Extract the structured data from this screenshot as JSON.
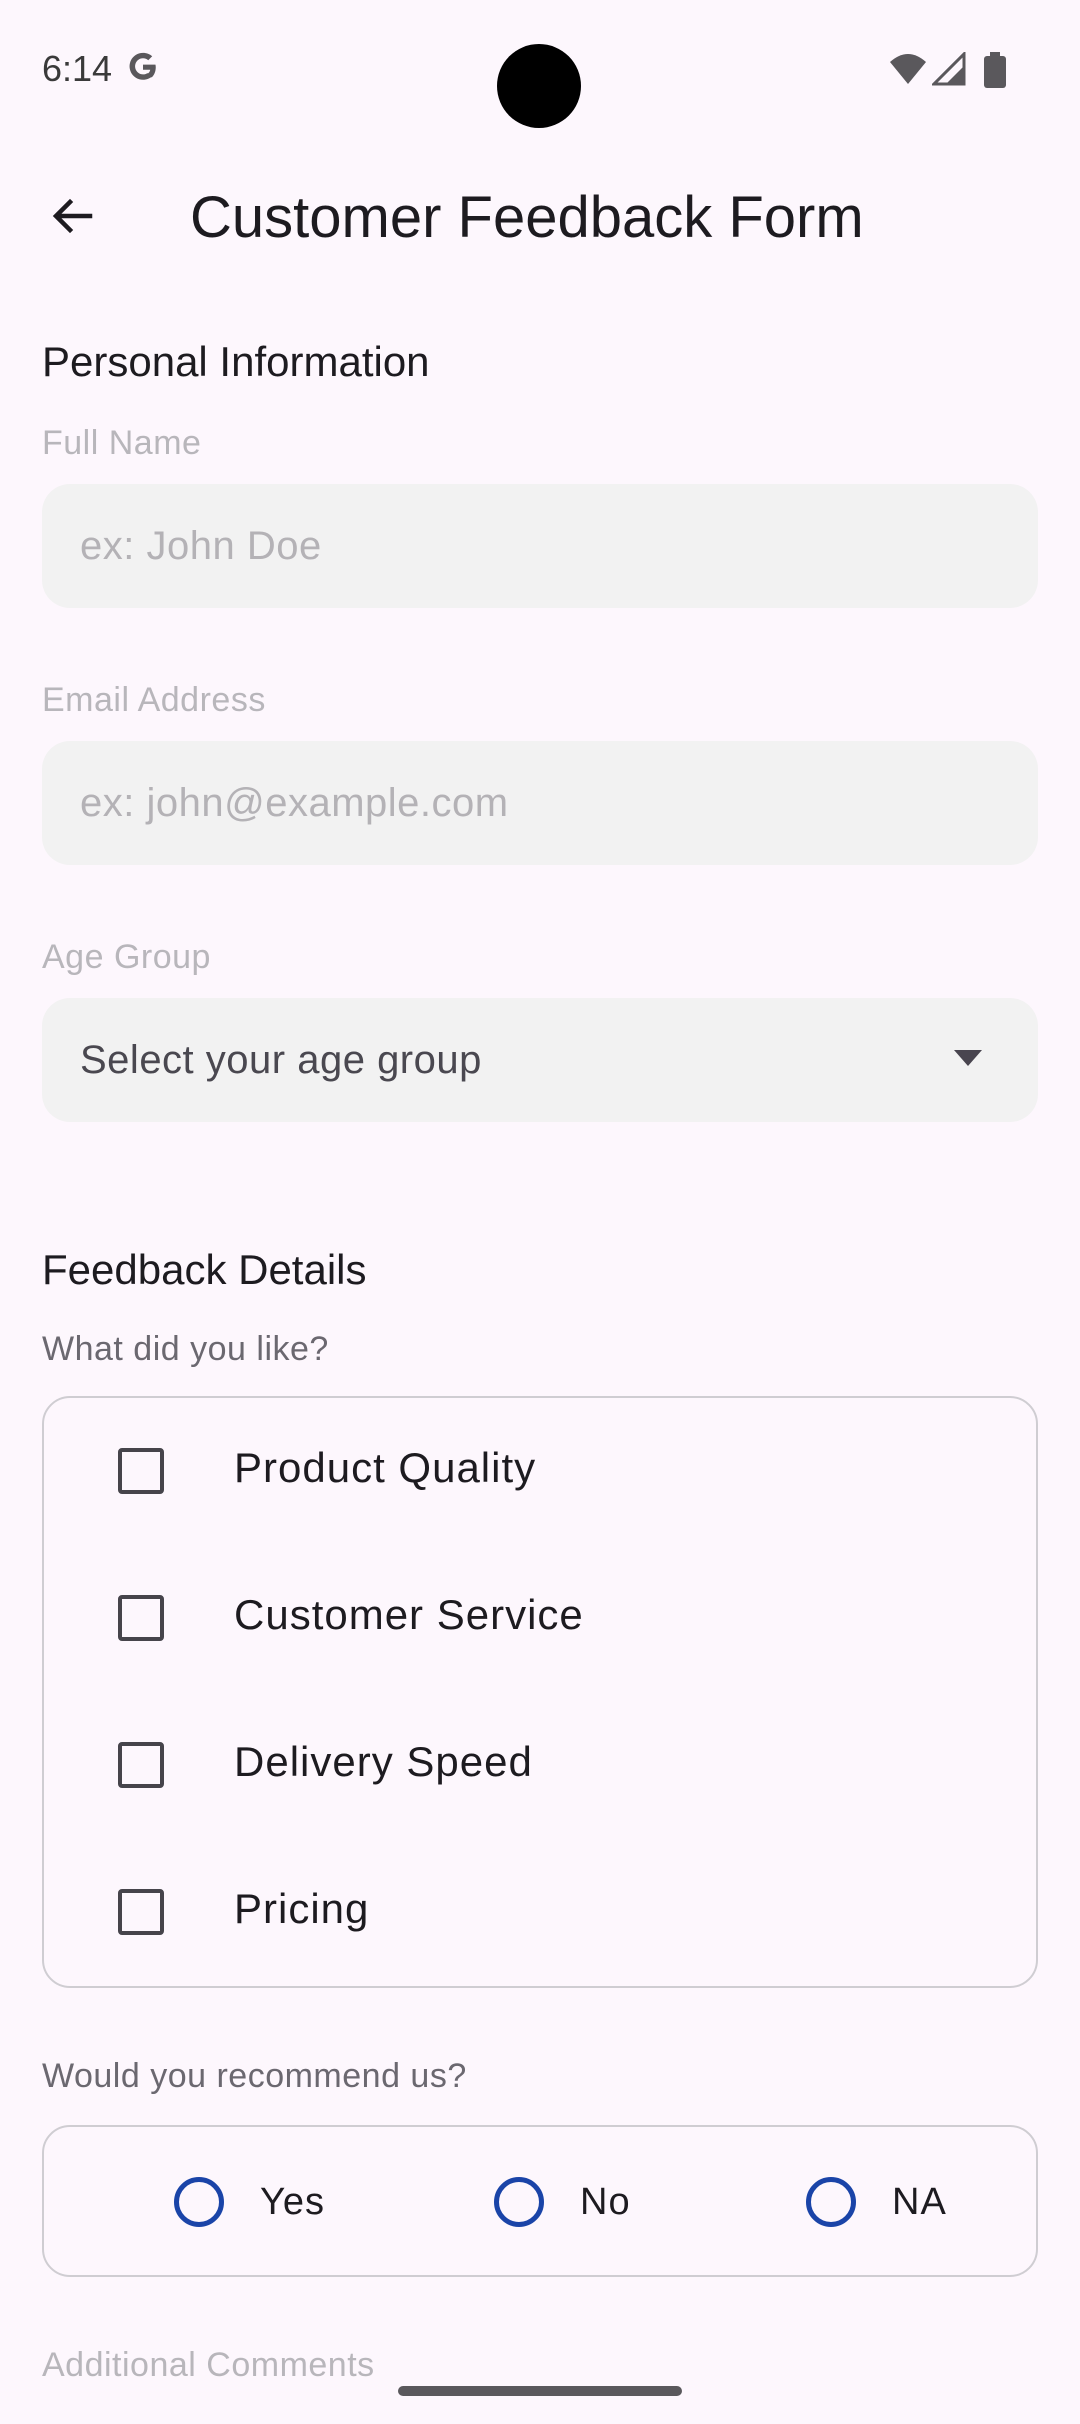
{
  "status_bar": {
    "time": "6:14"
  },
  "app_bar": {
    "title": "Customer Feedback Form"
  },
  "personal_section": {
    "title": "Personal Information",
    "full_name": {
      "label": "Full Name",
      "placeholder": "ex: John Doe",
      "value": ""
    },
    "email": {
      "label": "Email Address",
      "placeholder": "ex: john@example.com",
      "value": ""
    },
    "age_group": {
      "label": "Age Group",
      "selected": "Select your age group"
    }
  },
  "feedback_section": {
    "title": "Feedback Details",
    "liked_question": "What did you like?",
    "liked_options": [
      {
        "label": "Product Quality",
        "checked": false
      },
      {
        "label": "Customer Service",
        "checked": false
      },
      {
        "label": "Delivery Speed",
        "checked": false
      },
      {
        "label": "Pricing",
        "checked": false
      }
    ],
    "recommend_question": "Would you recommend us?",
    "recommend_options": [
      {
        "label": "Yes",
        "selected": false
      },
      {
        "label": "No",
        "selected": false
      },
      {
        "label": "NA",
        "selected": false
      }
    ],
    "comments_label": "Additional Comments"
  },
  "colors": {
    "background": "#fdf7fd",
    "field_fill": "#f2f2f2",
    "radio_accent": "#1a44a8",
    "text_primary": "#1d1b20"
  }
}
